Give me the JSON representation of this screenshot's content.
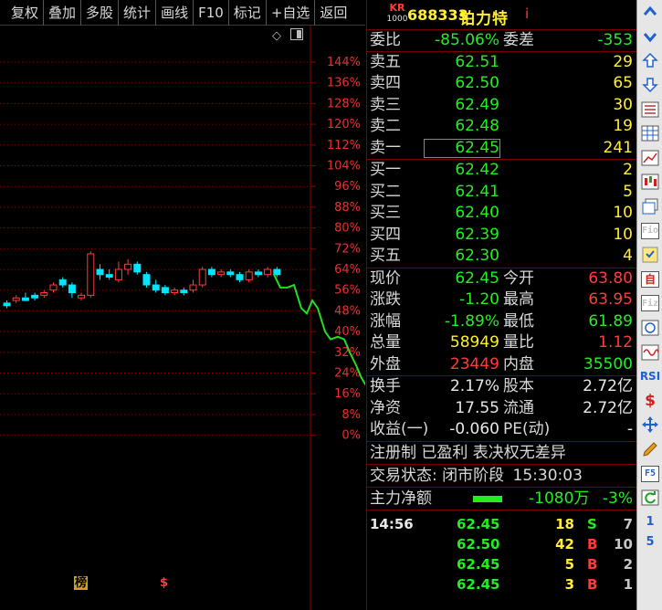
{
  "toolbar": {
    "buttons": [
      "复权",
      "叠加",
      "多股",
      "统计",
      "画线",
      "F10",
      "标记",
      "+自选",
      "返回"
    ]
  },
  "chart": {
    "pct_labels": [
      "144%",
      "136%",
      "128%",
      "120%",
      "112%",
      "104%",
      "96%",
      "88%",
      "80%",
      "72%",
      "64%",
      "56%",
      "48%",
      "40%",
      "32%",
      "24%",
      "16%",
      "8%",
      "0%"
    ],
    "bottom_marks": {
      "bang": "榜",
      "dollar": "$"
    },
    "colors": {
      "up": "#ff3c3c",
      "down": "#00e5ff",
      "grid": "#8b0000",
      "overlay": "#22dd22"
    }
  },
  "stock": {
    "logo_top": "KR",
    "logo_bottom": "1000",
    "code": "688333",
    "name": "铂力特",
    "info_icon": "i"
  },
  "commission": {
    "ratio_label": "委比",
    "ratio_value": "-85.06%",
    "diff_label": "委差",
    "diff_value": "-353"
  },
  "asks": [
    {
      "label": "卖五",
      "price": "62.51",
      "vol": "29"
    },
    {
      "label": "卖四",
      "price": "62.50",
      "vol": "65"
    },
    {
      "label": "卖三",
      "price": "62.49",
      "vol": "30"
    },
    {
      "label": "卖二",
      "price": "62.48",
      "vol": "19"
    },
    {
      "label": "卖一",
      "price": "62.45",
      "vol": "241"
    }
  ],
  "bids": [
    {
      "label": "买一",
      "price": "62.42",
      "vol": "2"
    },
    {
      "label": "买二",
      "price": "62.41",
      "vol": "5"
    },
    {
      "label": "买三",
      "price": "62.40",
      "vol": "10"
    },
    {
      "label": "买四",
      "price": "62.39",
      "vol": "10"
    },
    {
      "label": "买五",
      "price": "62.30",
      "vol": "4"
    }
  ],
  "quote": [
    {
      "l1": "现价",
      "v1": "62.45",
      "c1": "green",
      "l2": "今开",
      "v2": "63.80",
      "c2": "red"
    },
    {
      "l1": "涨跌",
      "v1": "-1.20",
      "c1": "green",
      "l2": "最高",
      "v2": "63.95",
      "c2": "red"
    },
    {
      "l1": "涨幅",
      "v1": "-1.89%",
      "c1": "green",
      "l2": "最低",
      "v2": "61.89",
      "c2": "green"
    },
    {
      "l1": "总量",
      "v1": "58949",
      "c1": "yellow",
      "l2": "量比",
      "v2": "1.12",
      "c2": "red"
    },
    {
      "l1": "外盘",
      "v1": "23449",
      "c1": "red",
      "l2": "内盘",
      "v2": "35500",
      "c2": "green"
    }
  ],
  "fundamentals": [
    {
      "l1": "换手",
      "v1": "2.17%",
      "l2": "股本",
      "v2": "2.72亿"
    },
    {
      "l1": "净资",
      "v1": "17.55",
      "l2": "流通",
      "v2": "2.72亿"
    },
    {
      "l1": "收益(一)",
      "v1": "-0.060",
      "l2": "PE(动)",
      "v2": "-"
    }
  ],
  "tags": "注册制 已盈利 表决权无差异",
  "trade_status": {
    "label": "交易状态:",
    "value": "闭市阶段",
    "time": "15:30:03"
  },
  "main_flow": {
    "label": "主力净额",
    "value": "-1080万",
    "pct": "-3%"
  },
  "ticks": [
    {
      "time": "14:56",
      "price": "62.45",
      "qty": "18",
      "side": "S",
      "n": "7"
    },
    {
      "time": "",
      "price": "62.50",
      "qty": "42",
      "side": "B",
      "n": "10"
    },
    {
      "time": "",
      "price": "62.45",
      "qty": "5",
      "side": "B",
      "n": "2"
    },
    {
      "time": "",
      "price": "62.45",
      "qty": "3",
      "side": "B",
      "n": "1"
    }
  ],
  "iconbar": [
    "chevron-up",
    "chevron-down",
    "arrow-up",
    "arrow-down",
    "tick-list",
    "grid-table",
    "line-chart",
    "kline-chart",
    "pages",
    "F10",
    "info-doc",
    "自",
    "F12",
    "circle",
    "wave",
    "RSI",
    "$",
    "move",
    "pencil",
    "F5",
    "refresh",
    "1",
    "5"
  ]
}
